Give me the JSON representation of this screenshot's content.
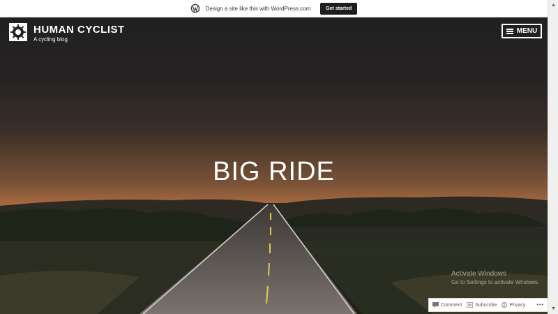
{
  "promo": {
    "text": "Design a site like this with WordPress.com",
    "button": "Get started"
  },
  "site": {
    "title": "HUMAN CYCLIST",
    "tagline": "A cycling blog",
    "menu_label": "MENU"
  },
  "hero": {
    "title": "BIG RIDE"
  },
  "watermark": {
    "title": "Activate Windows",
    "subtitle": "Go to Settings to activate Windows."
  },
  "actions": {
    "comment": "Comment",
    "subscribe": "Subscribe",
    "privacy": "Privacy",
    "more": "•••"
  },
  "colors": {
    "promo_button": "#1d1d1d",
    "sky_glow": "#a8693f"
  }
}
